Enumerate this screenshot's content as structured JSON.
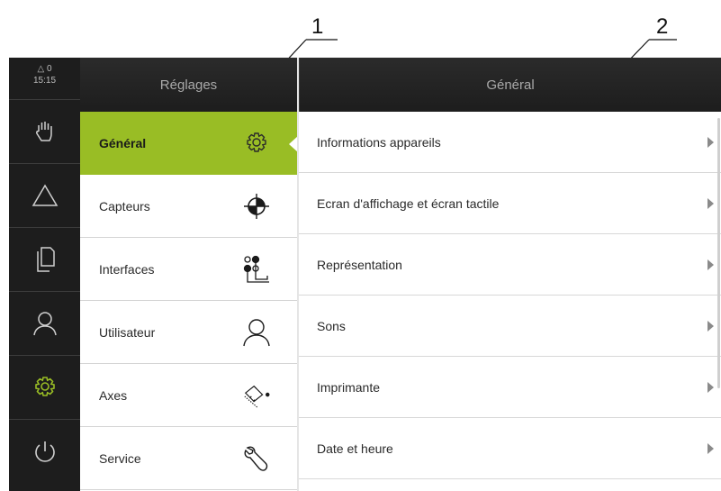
{
  "callouts": {
    "one": "1",
    "two": "2"
  },
  "status": {
    "alerts": "0",
    "time": "15:15"
  },
  "rail": {
    "items": [
      {
        "name": "manual-mode",
        "icon": "hand-icon"
      },
      {
        "name": "measure",
        "icon": "triangle-icon"
      },
      {
        "name": "files",
        "icon": "document-icon"
      },
      {
        "name": "user",
        "icon": "user-icon"
      },
      {
        "name": "settings",
        "icon": "gear-icon",
        "active": true
      },
      {
        "name": "power",
        "icon": "power-icon"
      }
    ]
  },
  "middle": {
    "title": "Réglages",
    "items": [
      {
        "label": "Général",
        "icon": "gear-icon",
        "active": true
      },
      {
        "label": "Capteurs",
        "icon": "crosshair-target-icon"
      },
      {
        "label": "Interfaces",
        "icon": "interfaces-icon"
      },
      {
        "label": "Utilisateur",
        "icon": "user-icon"
      },
      {
        "label": "Axes",
        "icon": "axes-encoder-icon"
      },
      {
        "label": "Service",
        "icon": "wrench-icon"
      }
    ]
  },
  "right": {
    "title": "Général",
    "items": [
      {
        "label": "Informations appareils"
      },
      {
        "label": "Ecran d'affichage et écran tactile"
      },
      {
        "label": "Représentation"
      },
      {
        "label": "Sons"
      },
      {
        "label": "Imprimante"
      },
      {
        "label": "Date et heure"
      }
    ]
  },
  "colors": {
    "accent": "#99bd25",
    "dark": "#1d1d1d"
  }
}
